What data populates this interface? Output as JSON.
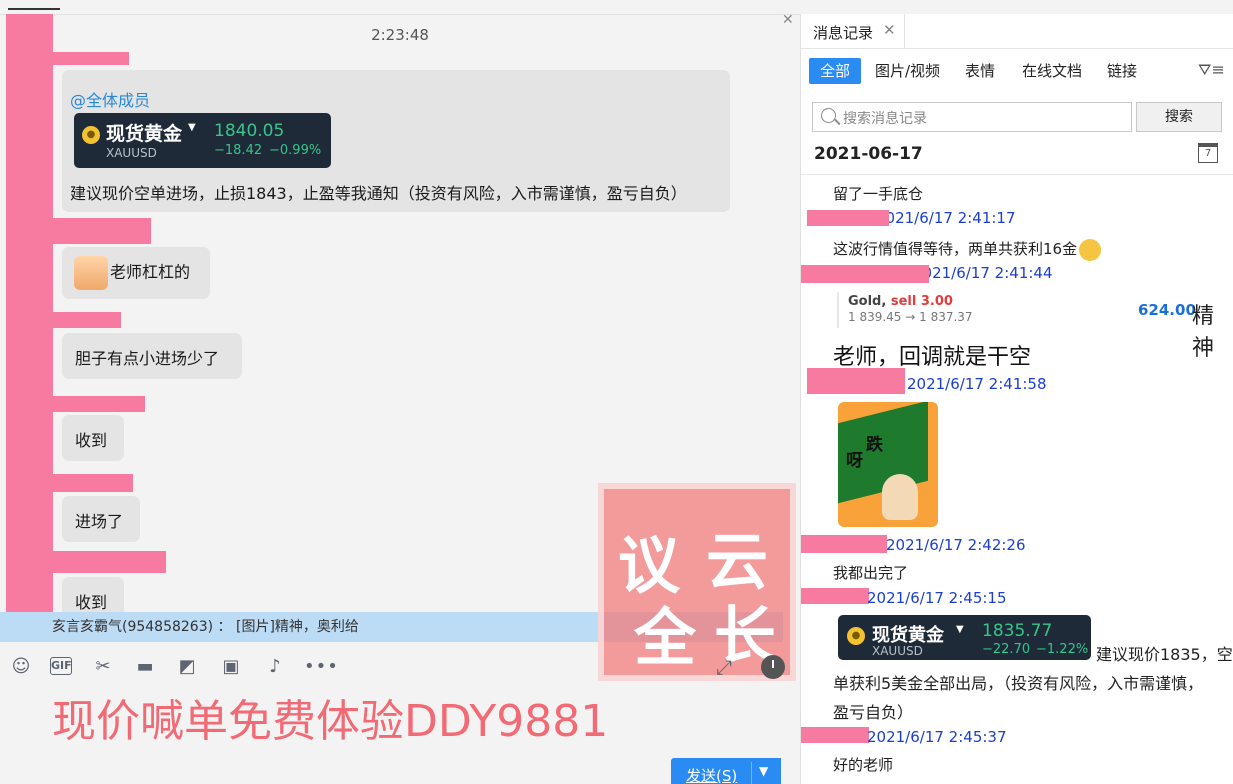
{
  "chat": {
    "time": "2:23:48",
    "msg1": {
      "mention": "@全体成员",
      "ticker": {
        "name": "现货黄金",
        "symbol": "XAUUSD",
        "price": "1840.05",
        "change": "−18.42",
        "pct": "−0.99%"
      },
      "text": "建议现价空单进场，止损1843，止盈等我通知（投资有风险，入市需谨慎，盈亏自负）"
    },
    "msg2": "老师杠杠的",
    "msg3": "胆子有点小进场少了",
    "msg4": "收到",
    "msg5": "进场了",
    "msg6": "收到",
    "notice": "亥言亥霸气(954858263) ： [图片]精神，奥利给",
    "promo": "现价喊单免费体验DDY9881",
    "send_label": "发送(S)",
    "watermark": [
      "议",
      "云",
      "全",
      "长"
    ]
  },
  "panel": {
    "tab_title": "消息记录",
    "filters": [
      "全部",
      "图片/视频",
      "表情",
      "在线文档",
      "链接"
    ],
    "search_placeholder": "搜索消息记录",
    "search_button": "搜索",
    "date": "2021-06-17",
    "calendar_day": "7",
    "messages": {
      "m1": "留了一手底仓",
      "t1": "2021/6/17 2:41:17",
      "m2": "这波行情值得等待，两单共获利16金",
      "t2": "2021/6/17 2:41:44",
      "trade": {
        "gold": "Gold,",
        "sell": "sell 3.00",
        "range": "1 839.45 → 1 837.37",
        "profit": "624.00"
      },
      "jingshen": "精神",
      "m3": "老师，回调就是干空",
      "t3": "2021/6/17 2:41:58",
      "sticker": [
        "跌",
        "呀"
      ],
      "t4": "2021/6/17 2:42:26",
      "m4": "我都出完了",
      "t5": "2021/6/17 2:45:15",
      "ticker": {
        "name": "现货黄金",
        "symbol": "XAUUSD",
        "price": "1835.77",
        "change": "−22.70",
        "pct": "−1.22%"
      },
      "m5a": "建议现价1835，空",
      "m5b": "单获利5美金全部出局，（投资有风险，入市需谨慎，",
      "m5c": "盈亏自负）",
      "t6": "2021/6/17 2:45:37",
      "m6": "好的老师"
    }
  },
  "colors": {
    "accent": "#2a8bf2",
    "redact": "#f77ba0",
    "promo": "#f16a74",
    "time_blue": "#1a3fd0"
  }
}
